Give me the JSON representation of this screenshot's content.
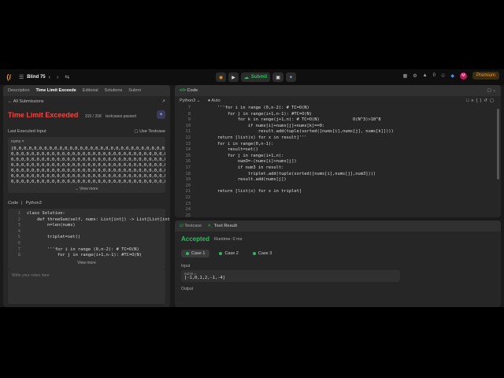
{
  "nav": {
    "list_title": "Blind 75",
    "submit_label": "Submit",
    "count": "0",
    "premium_label": "Premium",
    "avatar_letter": "M"
  },
  "left_tabs": [
    "Description",
    "Time Limit Exceede",
    "Editorial",
    "Solutions",
    "Submi"
  ],
  "all_submissions": "All Submissions",
  "result": {
    "status": "Time Limit Exceeded",
    "passed": "315 / 318",
    "passed_suffix": "testcases passed"
  },
  "last_input": {
    "label": "Last Executed Input",
    "use_testcase": "Use Testcase",
    "var_label": "nums =",
    "lines": [
      "[0,0,0,0,0,0,0,0,0,0,0,0,0,0,0,0,0,0,0,0,0,0,0,0,0,0,0,0,0,0,0,0",
      "0,0,0,0,0,0,0,0,0,0,0,0,0,0,0,0,0,0,0,0,0,0,0,0,0,0,0,0,0,0,0,0",
      "0,0,0,0,0,0,0,0,0,0,0,0,0,0,0,0,0,0,0,0,0,0,0,0,0,0,0,0,0,0,0,0",
      "0,0,0,0,0,0,0,0,0,0,0,0,0,0,0,0,0,0,0,0,0,0,0,0,0,0,0,0,0,0,0,0",
      "0,0,0,0,0,0,0,0,0,0,0,0,0,0,0,0,0,0,0,0,0,0,0,0,0,0,0,0,0,0,0,0",
      "0,0,0,0,0,0,0,0,0,0,0,0,0,0,0,0,0,0,0,0,0,0,0,0,0,0,0,0,0,0,0,0",
      "0,0,0,0,0,0,0,0,0,0,0,0,0,0,0,0,0,0,0,0,0,0,0,0,0,0,0,0,0,0,0,0"
    ],
    "view_more": "View more"
  },
  "code_section": {
    "label": "Code",
    "lang": "Python3",
    "lines": [
      {
        "n": "1",
        "t": "class Solution:"
      },
      {
        "n": "2",
        "t": "    def threeSum(self, nums: List[int]) -> List[List[int]]:"
      },
      {
        "n": "3",
        "t": "        n=len(nums)"
      },
      {
        "n": "4",
        "t": ""
      },
      {
        "n": "5",
        "t": "        triplet=set()"
      },
      {
        "n": "6",
        "t": ""
      },
      {
        "n": "7",
        "t": "        '''for i in range (0,n-2): # TC=O(N)"
      },
      {
        "n": "8",
        "t": "            for j in range(i+1,n-1): #TC=O(N)"
      }
    ],
    "view_more": "View more"
  },
  "notes_placeholder": "Write your notes here",
  "editor": {
    "tab": "Code",
    "lang": "Python3",
    "auto": "Auto",
    "lines": [
      {
        "n": "7",
        "t": "        '''for i in range (0,n-2): # TC=O(N)"
      },
      {
        "n": "8",
        "t": "            for j in range(i+1,n-1): #TC=O(N)"
      },
      {
        "n": "9",
        "t": "                for k in range(j+1,n): # TC=O(N)             O(N^3)>10^8"
      },
      {
        "n": "10",
        "t": "                    if nums[i]+nums[j]+nums[k]==0:"
      },
      {
        "n": "11",
        "t": "                        result.add(tuple(sorted([nums[i],nums[j], nums[k]])))"
      },
      {
        "n": "12",
        "t": "        return [list(x) for x in result]'''"
      },
      {
        "n": "13",
        "t": "        for i in range(0,n-1):"
      },
      {
        "n": "14",
        "t": "            result=set()"
      },
      {
        "n": "15",
        "t": "            for j in range(i+1,n):"
      },
      {
        "n": "16",
        "t": "                num3=-(nums[i]+nums[j])"
      },
      {
        "n": "17",
        "t": "                if num3 in result:"
      },
      {
        "n": "18",
        "t": "                    triplet.add(tuple(sorted([nums[i],nums[j],num3])))"
      },
      {
        "n": "19",
        "t": "                result.add(nums[j])"
      },
      {
        "n": "20",
        "t": ""
      },
      {
        "n": "21",
        "t": "        return [list(x) for x in triplet]"
      },
      {
        "n": "22",
        "t": ""
      },
      {
        "n": "23",
        "t": ""
      },
      {
        "n": "24",
        "t": ""
      },
      {
        "n": "25",
        "t": ""
      }
    ]
  },
  "test": {
    "tab_testcase": "Testcase",
    "tab_result": "Test Result",
    "accepted": "Accepted",
    "runtime": "Runtime: 0 ms",
    "cases": [
      "Case 1",
      "Case 2",
      "Case 3"
    ],
    "input_label": "Input",
    "var_label": "nums =",
    "input_value": "[-1,0,1,2,-1,-4]",
    "output_label": "Output"
  },
  "colors": {
    "accent_orange": "#f89f1b",
    "tle_red": "#ef4743",
    "accepted_green": "#2cbb5d",
    "panel_bg": "#262626"
  }
}
